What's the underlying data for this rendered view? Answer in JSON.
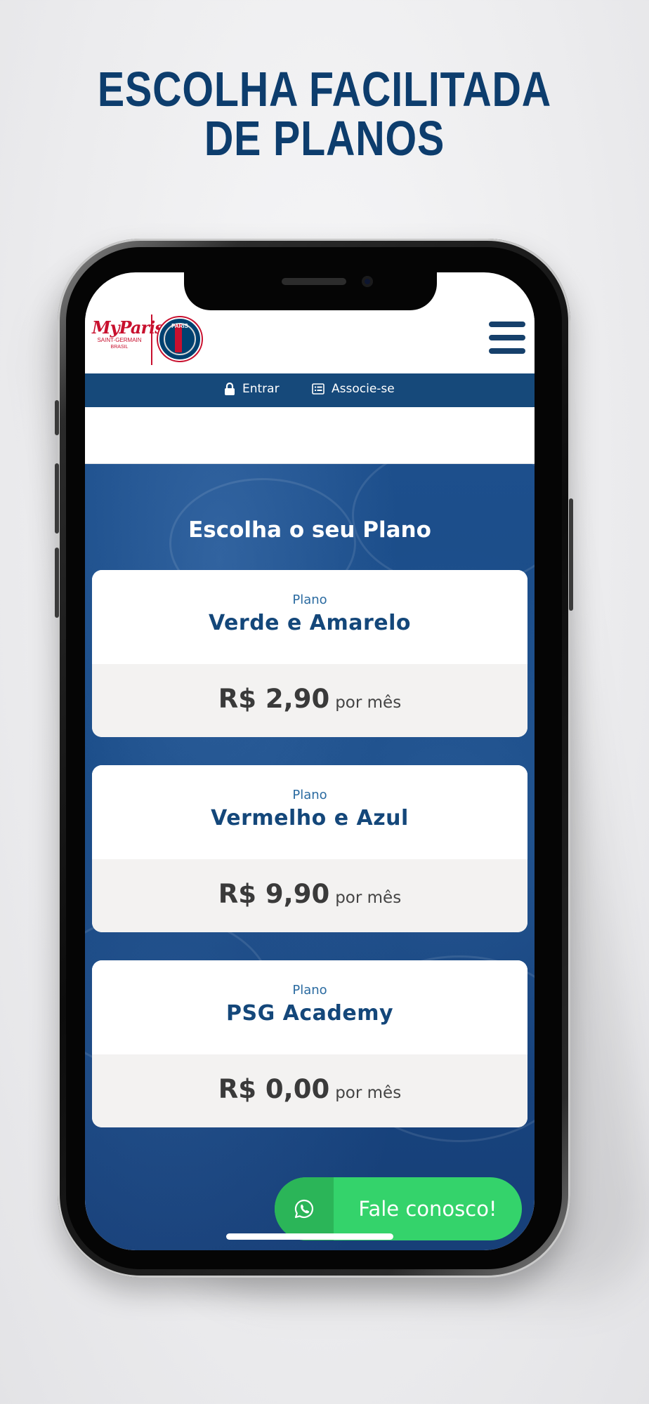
{
  "headline": {
    "line1": "ESCOLHA FACILITADA",
    "line2": "DE PLANOS"
  },
  "app": {
    "logo": {
      "myparis_text": "MyParis",
      "myparis_sub": "SAINT-GERMAIN",
      "myparis_country": "BRASIL",
      "crest_text": "PARIS"
    },
    "topbar": {
      "login_label": "Entrar",
      "signup_label": "Associe-se"
    },
    "section_title": "Escolha o seu Plano",
    "plans": [
      {
        "kicker": "Plano",
        "name": "Verde e Amarelo",
        "price": "R$ 2,90",
        "period": "por mês"
      },
      {
        "kicker": "Plano",
        "name": "Vermelho e Azul",
        "price": "R$ 9,90",
        "period": "por mês"
      },
      {
        "kicker": "Plano",
        "name": "PSG Academy",
        "price": "R$ 0,00",
        "period": "por mês"
      }
    ],
    "whatsapp_button": {
      "label": "Fale conosco!",
      "icon": "whatsapp-icon"
    }
  },
  "colors": {
    "headline": "#0d3d6d",
    "topbar": "#16497a",
    "plan_name": "#14477a",
    "whatsapp": "#34d36b",
    "brand_red": "#c8102e"
  }
}
